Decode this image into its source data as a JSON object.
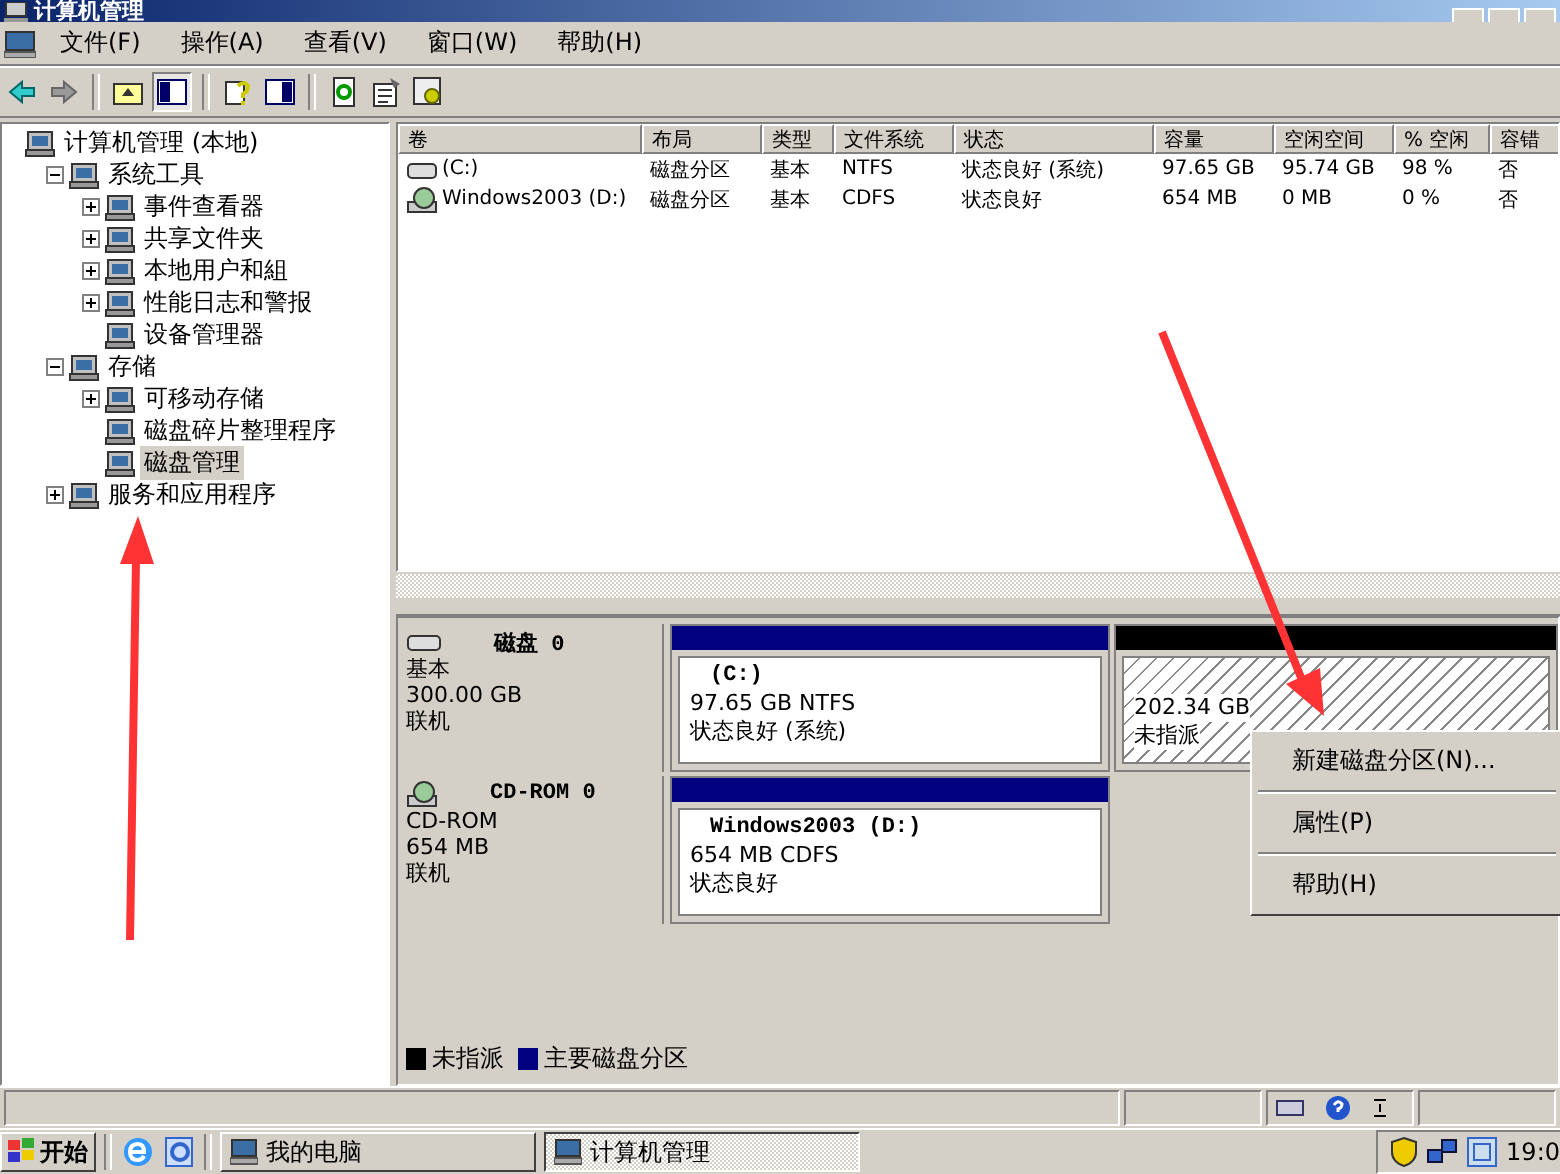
{
  "window": {
    "title": "计算机管理"
  },
  "menu": [
    "文件(F)",
    "操作(A)",
    "查看(V)",
    "窗口(W)",
    "帮助(H)"
  ],
  "toolbar": [
    {
      "kind": "back",
      "pressed": false
    },
    {
      "kind": "forward",
      "pressed": false
    },
    {
      "kind": "sep"
    },
    {
      "kind": "up",
      "pressed": false
    },
    {
      "kind": "tree",
      "pressed": true
    },
    {
      "kind": "sep"
    },
    {
      "kind": "help",
      "pressed": false
    },
    {
      "kind": "panel",
      "pressed": false
    },
    {
      "kind": "sep"
    },
    {
      "kind": "refresh",
      "pressed": false
    },
    {
      "kind": "props",
      "pressed": false
    },
    {
      "kind": "settings",
      "pressed": false
    }
  ],
  "tree": [
    {
      "label": "计算机管理 (本地)",
      "expandable": false,
      "selected": false,
      "children": [
        {
          "label": "系统工具",
          "expandable": true,
          "expanded": true,
          "selected": false,
          "children": [
            {
              "label": "事件查看器",
              "expandable": true,
              "expanded": false,
              "selected": false
            },
            {
              "label": "共享文件夹",
              "expandable": true,
              "expanded": false,
              "selected": false
            },
            {
              "label": "本地用户和組",
              "expandable": true,
              "expanded": false,
              "selected": false
            },
            {
              "label": "性能日志和警报",
              "expandable": true,
              "expanded": false,
              "selected": false
            },
            {
              "label": "设备管理器",
              "expandable": false,
              "selected": false
            }
          ]
        },
        {
          "label": "存储",
          "expandable": true,
          "expanded": true,
          "selected": false,
          "children": [
            {
              "label": "可移动存储",
              "expandable": true,
              "expanded": false,
              "selected": false
            },
            {
              "label": "磁盘碎片整理程序",
              "expandable": false,
              "selected": false
            },
            {
              "label": "磁盘管理",
              "expandable": false,
              "selected": true
            }
          ]
        },
        {
          "label": "服务和应用程序",
          "expandable": true,
          "expanded": false,
          "selected": false
        }
      ]
    }
  ],
  "volume_list": {
    "columns": [
      "卷",
      "布局",
      "类型",
      "文件系统",
      "状态",
      "容量",
      "空闲空间",
      "% 空闲",
      "容错"
    ],
    "rows": [
      {
        "kind": "hard-disk",
        "cells": [
          "(C:)",
          "磁盘分区",
          "基本",
          "NTFS",
          "状态良好 (系统)",
          "97.65 GB",
          "95.74 GB",
          "98 %",
          "否"
        ]
      },
      {
        "kind": "cd-drive",
        "cells": [
          "Windows2003 (D:)",
          "磁盘分区",
          "基本",
          "CDFS",
          "状态良好",
          "654 MB",
          "0 MB",
          "0 %",
          "否"
        ]
      }
    ]
  },
  "disks": [
    {
      "kind": "hard-disk",
      "name": "磁盘 0",
      "type": "基本",
      "size": "300.00 GB",
      "status": "联机",
      "partitions": [
        {
          "kind": "primary",
          "label": "(C:)",
          "detail": "97.65 GB NTFS",
          "status": "状态良好 (系统)"
        },
        {
          "kind": "unallocated",
          "detail": "202.34 GB",
          "status": "未指派"
        }
      ]
    },
    {
      "kind": "cd-drive",
      "name": "CD-ROM 0",
      "type": "CD-ROM",
      "size": "654 MB",
      "status": "联机",
      "partitions": [
        {
          "kind": "primary",
          "label": "Windows2003  (D:)",
          "detail": "654 MB CDFS",
          "status": "状态良好"
        }
      ]
    }
  ],
  "legend": [
    {
      "label": "未指派",
      "color": "#000000"
    },
    {
      "label": "主要磁盘分区",
      "color": "#000080"
    }
  ],
  "context_menu": [
    "新建磁盘分区(N)...",
    "属性(P)",
    "帮助(H)"
  ],
  "taskbar": {
    "start": "开始",
    "tasks": [
      {
        "label": "我的电脑",
        "selected": false
      },
      {
        "label": "计算机管理",
        "selected": true
      }
    ],
    "clock": "19:0"
  }
}
